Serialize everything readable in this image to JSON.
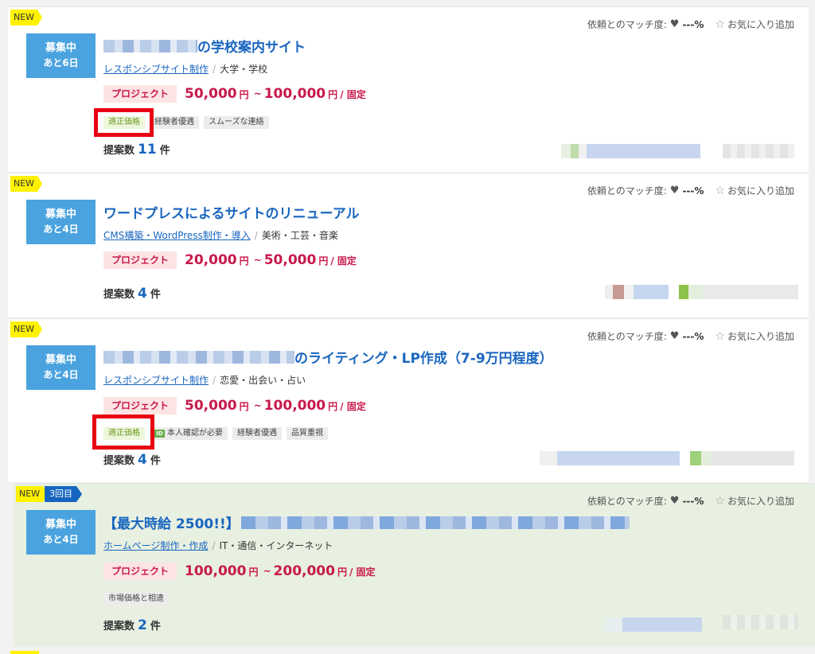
{
  "match_label": "依頼とのマッチ度:",
  "match_value": "---%",
  "favorite_label": "お気に入り追加",
  "new_label": "NEW",
  "project_type": "プロジェクト",
  "proposal_label": "提案数",
  "proposal_unit": "件",
  "yen_unit": "円",
  "range_sep": "~",
  "fixed_label": "/ 固定",
  "listings": [
    {
      "status": "募集中",
      "days_left": "あと6日",
      "title": "の学校案内サイト",
      "category_link": "レスポンシブサイト制作",
      "industry": "大学・学校",
      "price_min": "50,000",
      "price_max": "100,000",
      "tags": [
        "適正価格",
        "経験者優遇",
        "スムーズな連絡"
      ],
      "proposals": "11"
    },
    {
      "status": "募集中",
      "days_left": "あと4日",
      "title": "ワードプレスによるサイトのリニューアル",
      "category_link": "CMS構築・WordPress制作・導入",
      "industry": "美術・工芸・音楽",
      "price_min": "20,000",
      "price_max": "50,000",
      "tags": [],
      "proposals": "4"
    },
    {
      "status": "募集中",
      "days_left": "あと4日",
      "title": "のライティング・LP作成（7-9万円程度）",
      "category_link": "レスポンシブサイト制作",
      "industry": "恋愛・出会い・占い",
      "price_min": "50,000",
      "price_max": "100,000",
      "tags": [
        "適正価格",
        "本人確認が必要",
        "経験者優遇",
        "品質重視"
      ],
      "id_icon_text": "ID",
      "proposals": "4"
    },
    {
      "status": "募集中",
      "days_left": "あと4日",
      "round_label": "3回目",
      "title": "【最大時給 2500!!】",
      "category_link": "ホームページ制作・作成",
      "industry": "IT・通信・インターネット",
      "price_min": "100,000",
      "price_max": "200,000",
      "tags": [
        "市場価格と相違"
      ],
      "proposals": "2"
    }
  ],
  "colors": {
    "accent_blue": "#1a66c0",
    "status_blue": "#4aa3df",
    "price_red": "#c8184a",
    "new_yellow": "#fff200",
    "highlight_bg": "#e8f0e1",
    "annotation_red": "#e60012"
  }
}
